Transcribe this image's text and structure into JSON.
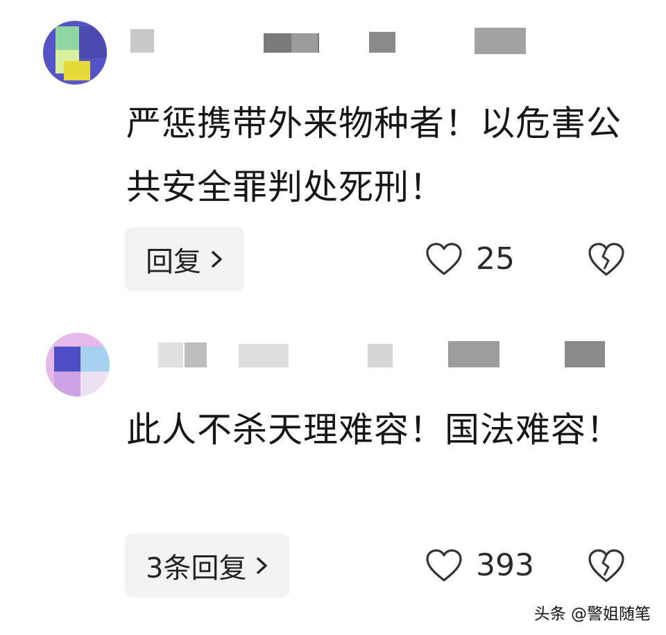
{
  "comments": [
    {
      "text": "严惩携带外来物种者！以危害公共安全罪判处死刑！",
      "reply_label": "回复",
      "like_count": "25"
    },
    {
      "text": "此人不杀天理难容！国法难容！",
      "reply_label": "3条回复",
      "like_count": "393"
    }
  ],
  "watermark": "头条 @警姐随笔",
  "colors": {
    "background": "#ffffff",
    "reply_button_bg": "#f3f3f3",
    "icon_stroke": "#333333"
  },
  "icons": {
    "like": "heart-outline-icon",
    "dislike": "broken-heart-icon",
    "reply": "chevron-right-icon"
  }
}
